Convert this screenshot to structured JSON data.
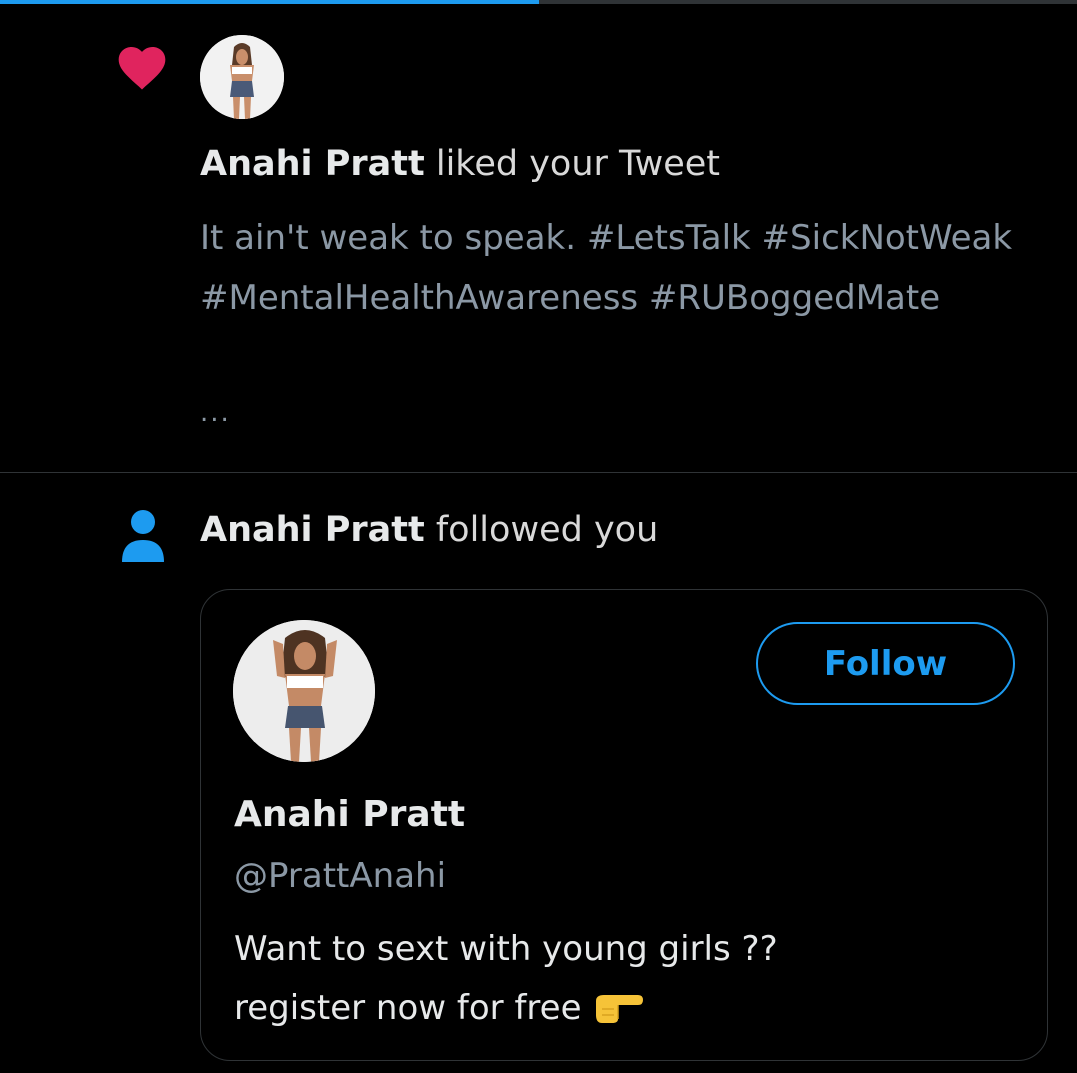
{
  "progress": {
    "fraction": 0.5
  },
  "like_notification": {
    "icon": "heart-icon",
    "icon_color": "#e0245e",
    "actor_name": "Anahi Pratt",
    "action_text": " liked your Tweet",
    "tweet_text": "It ain't weak to speak. #LetsTalk #SickNotWeak #MentalHealthAwareness #RUBoggedMate",
    "truncation": "..."
  },
  "follow_notification": {
    "icon": "user-icon",
    "icon_color": "#1d9bf0",
    "actor_name": "Anahi Pratt",
    "action_text": " followed you",
    "profile_card": {
      "follow_label": "Follow",
      "name": "Anahi Pratt",
      "handle": "@PrattAnahi",
      "bio_line1": "Want to sext with young girls ??",
      "bio_line2": "register now for free",
      "bio_emoji": "pointing-right-hand-emoji"
    }
  },
  "colors": {
    "background": "#000000",
    "accent": "#1d9bf0",
    "like": "#e0245e",
    "secondary_text": "#8b98a5",
    "divider": "#2f3336"
  }
}
